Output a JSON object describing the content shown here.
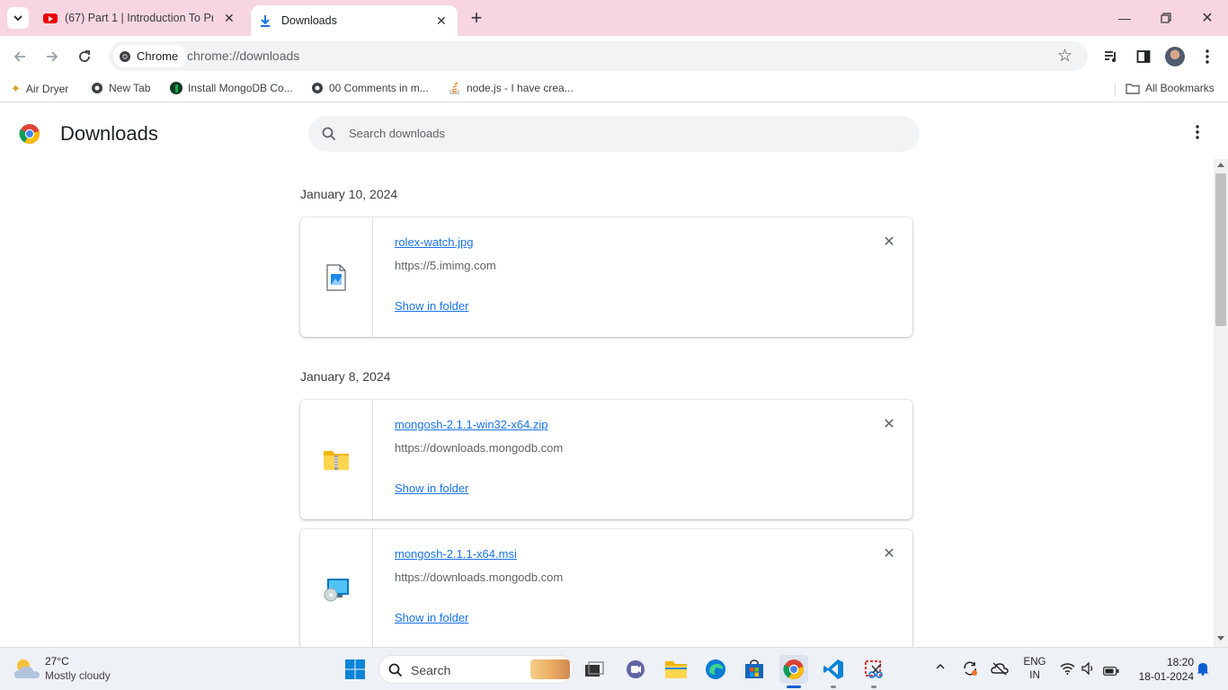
{
  "tabs": [
    {
      "title": "(67) Part 1 | Introduction To Pro",
      "icon": "youtube-icon"
    },
    {
      "title": "Downloads",
      "icon": "download-icon"
    }
  ],
  "toolbar": {
    "chip_label": "Chrome",
    "url": "chrome://downloads"
  },
  "bookmarks": [
    {
      "label": "Air Dryer"
    },
    {
      "label": "New Tab"
    },
    {
      "label": "Install MongoDB Co..."
    },
    {
      "label": "00 Comments in m..."
    },
    {
      "label": "node.js - I have crea..."
    }
  ],
  "all_bookmarks": "All Bookmarks",
  "page": {
    "title": "Downloads",
    "search_placeholder": "Search downloads"
  },
  "groups": [
    {
      "date": "January 10, 2024",
      "items": [
        {
          "filename": "rolex-watch.jpg",
          "source": "https://5.imimg.com",
          "action": "Show in folder",
          "icon": "image-file-icon"
        }
      ]
    },
    {
      "date": "January 8, 2024",
      "items": [
        {
          "filename": "mongosh-2.1.1-win32-x64.zip",
          "source": "https://downloads.mongodb.com",
          "action": "Show in folder",
          "icon": "zip-folder-icon"
        },
        {
          "filename": "mongosh-2.1.1-x64.msi",
          "source": "https://downloads.mongodb.com",
          "action": "Show in folder",
          "icon": "installer-icon"
        }
      ]
    }
  ],
  "taskbar": {
    "weather_temp": "27°C",
    "weather_desc": "Mostly cloudy",
    "search_label": "Search",
    "lang_line1": "ENG",
    "lang_line2": "IN",
    "time": "18:20",
    "date": "18-01-2024"
  },
  "colors": {
    "tabstrip": "#f7d6e2",
    "link": "#1a73e8",
    "accent": "#1a73e8"
  }
}
